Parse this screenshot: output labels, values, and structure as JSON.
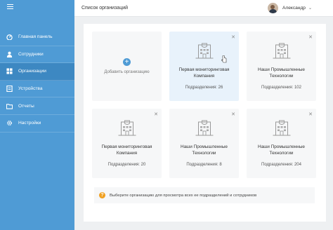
{
  "sidebar": {
    "items": [
      {
        "label": "Главная панель",
        "icon": "dashboard-icon"
      },
      {
        "label": "Сотрудники",
        "icon": "user-icon"
      },
      {
        "label": "Организации",
        "icon": "grid-icon",
        "active": true
      },
      {
        "label": "Устройства",
        "icon": "device-icon"
      },
      {
        "label": "Отчеты",
        "icon": "folder-icon"
      },
      {
        "label": "Настройки",
        "icon": "gear-icon"
      }
    ]
  },
  "header": {
    "title": "Список организаций",
    "user_name": "Александр"
  },
  "add_card": {
    "label": "Добавить организацию"
  },
  "organizations": [
    {
      "name": "Первая мониторинговая Компания",
      "divisions": "Подразделения: 26"
    },
    {
      "name": "Наши Промышленные Технологии",
      "divisions": "Подразделения: 102"
    },
    {
      "name": "Первая мониторинговая Компания",
      "divisions": "Подразделения: 20"
    },
    {
      "name": "Наши Промышленные Технологии",
      "divisions": "Подразделения: 8"
    },
    {
      "name": "Наши Промышленные Технологии",
      "divisions": "Подразделения: 204"
    }
  ],
  "hint": {
    "icon": "?",
    "text": "Выберите организацию для просмотра всех ее подразделений и сотрудников"
  },
  "colors": {
    "sidebar": "#4f9bd5",
    "sidebar_active": "#3d88c2",
    "accent": "#4f9bd5",
    "hint_icon": "#f0a020"
  }
}
